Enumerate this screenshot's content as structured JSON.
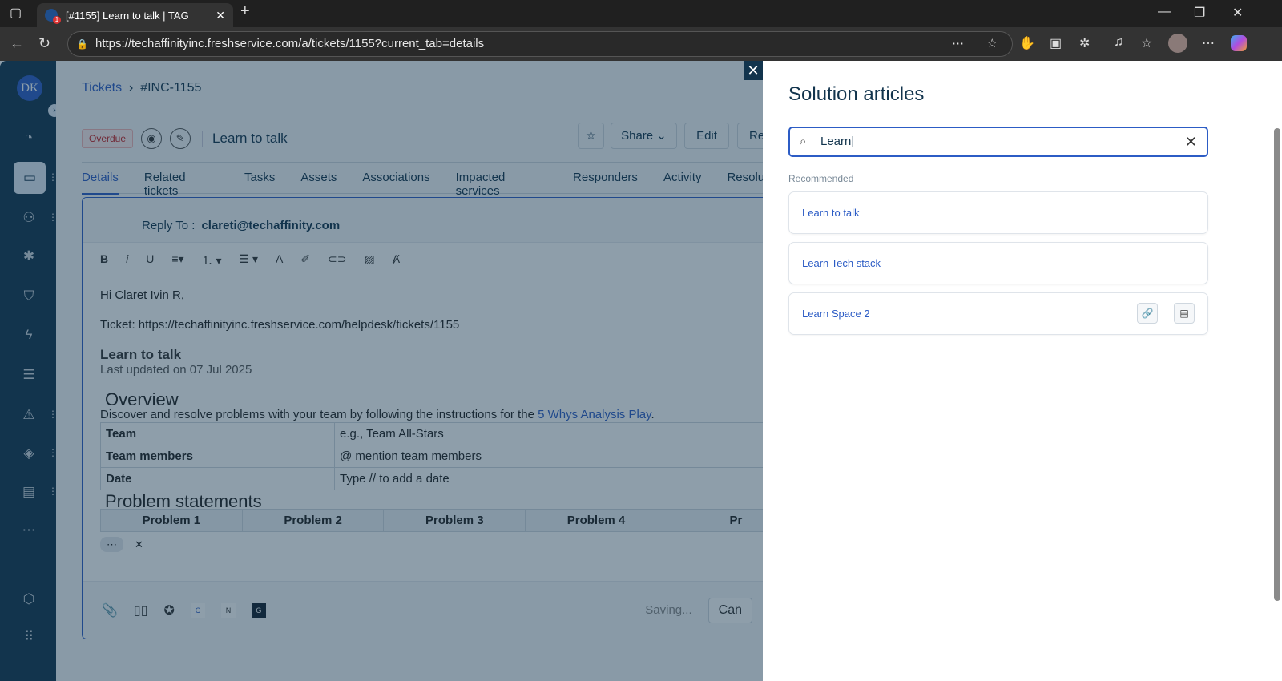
{
  "browser": {
    "tab_title": "[#1155] Learn to talk | TAG",
    "url": "https://techaffinityinc.freshservice.com/a/tickets/1155?current_tab=details"
  },
  "sidebar": {
    "avatar": "DK"
  },
  "breadcrumb": {
    "root": "Tickets",
    "current": "#INC-1155"
  },
  "ticket": {
    "status": "Overdue",
    "title": "Learn to talk"
  },
  "toolbar": {
    "share": "Share",
    "edit": "Edit",
    "more": "Re"
  },
  "tabs": [
    "Details",
    "Related tickets",
    "Tasks",
    "Assets",
    "Associations",
    "Impacted services",
    "Responders",
    "Activity",
    "Resolutio"
  ],
  "editor": {
    "reply_label": "Reply To :",
    "reply_email": "clareti@techaffinity.com",
    "greeting": "Hi Claret Ivin R,",
    "ticket_line": "Ticket: https://techaffinityinc.freshservice.com/helpdesk/tickets/1155",
    "article_title": "Learn to talk",
    "last_updated": "Last updated on 07 Jul 2025",
    "overview_heading": "Overview",
    "overview_text": "Discover and resolve problems with your team by following the instructions for the ",
    "overview_link": "5 Whys Analysis Play",
    "overview_end": ".",
    "rows": [
      {
        "k": "Team",
        "v": "e.g., Team All-Stars"
      },
      {
        "k": "Team members",
        "v": "@ mention team members"
      },
      {
        "k": "Date",
        "v": "Type // to add a date"
      }
    ],
    "problem_heading": "Problem statements",
    "problems": [
      "Problem 1",
      "Problem 2",
      "Problem 3",
      "Problem 4",
      "Pr"
    ],
    "saving": "Saving...",
    "cancel": "Can",
    "apps": [
      "C",
      "N",
      "G"
    ]
  },
  "panel": {
    "title": "Solution articles",
    "search_value": "Learn",
    "recommended": "Recommended",
    "articles": [
      "Learn to talk",
      "Learn Tech stack",
      "Learn Space 2"
    ]
  }
}
